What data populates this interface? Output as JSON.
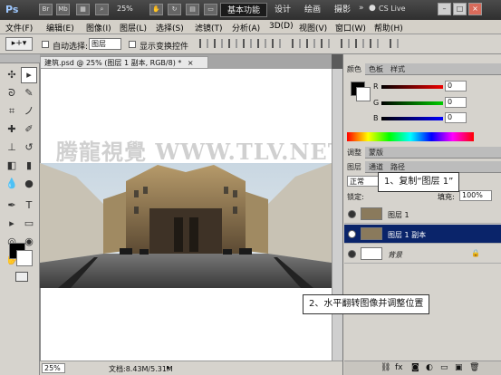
{
  "app": {
    "logo": "Ps",
    "zoom": "25%",
    "workspace_active": "基本功能",
    "workspaces": [
      "设计",
      "绘画",
      "摄影"
    ],
    "cslive": "CS Live",
    "win_buttons": [
      "–",
      "□",
      "×"
    ]
  },
  "menu": [
    "文件(F)",
    "编辑(E)",
    "图像(I)",
    "图层(L)",
    "选择(S)",
    "滤镜(T)",
    "分析(A)",
    "3D(D)",
    "视图(V)",
    "窗口(W)",
    "帮助(H)"
  ],
  "options": {
    "auto_select_label": "自动选择:",
    "auto_select_value": "图层",
    "show_transform": "显示变换控件"
  },
  "document": {
    "tab_title": "建筑.psd @ 25% (图层 1 副本, RGB/8) *",
    "watermark": "腾龍視覺 WWW.TLV.NET",
    "status_zoom": "25%",
    "status_doc": "文档:8.43M/5.31M"
  },
  "color_panel": {
    "tabs": [
      "颜色",
      "色板",
      "样式"
    ],
    "channels": [
      {
        "label": "R",
        "value": "0",
        "color": "#cc0000"
      },
      {
        "label": "G",
        "value": "0",
        "color": "#00aa00"
      },
      {
        "label": "B",
        "value": "0",
        "color": "#0000cc"
      }
    ]
  },
  "adjust_tabs": [
    "调整",
    "蒙版"
  ],
  "layers_panel": {
    "tabs": [
      "图层",
      "通道",
      "路径"
    ],
    "blend_mode": "正常",
    "lock_label": "锁定:",
    "fill_label": "填充:",
    "fill_value": "100%",
    "layers": [
      {
        "name": "图层 1",
        "selected": false,
        "thumb": "#8a7a5c"
      },
      {
        "name": "图层 1 副本",
        "selected": true,
        "thumb": "#8a7a5c"
      },
      {
        "name": "背景",
        "selected": false,
        "thumb": "#ffffff"
      }
    ]
  },
  "callouts": {
    "step1": "1、复制“图层 1”",
    "step2": "2、水平翻转图像并调整位置"
  }
}
